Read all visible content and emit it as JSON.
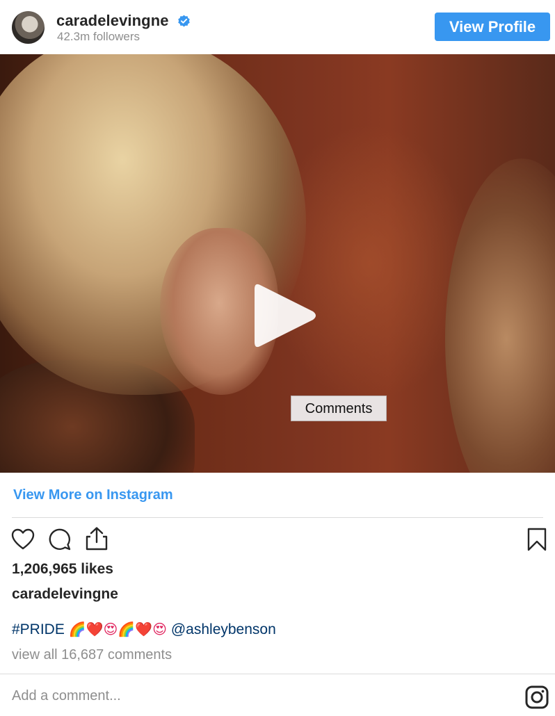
{
  "header": {
    "username": "caradelevingne",
    "followers": "42.3m followers",
    "view_profile_label": "View Profile"
  },
  "media": {
    "tooltip": "Comments"
  },
  "post": {
    "view_more_label": "View More on Instagram",
    "likes": "1,206,965 likes",
    "caption_user": "caradelevingne",
    "caption_hashtag": "#PRIDE",
    "caption_emojis": "🌈❤️😍🌈❤️😍",
    "caption_mention": "@ashleybenson",
    "view_all_comments": "view all 16,687 comments",
    "add_comment_placeholder": "Add a comment..."
  },
  "icons": {
    "verified": "verified-badge-icon",
    "play": "play-icon",
    "like": "heart-icon",
    "comment": "comment-icon",
    "share": "share-icon",
    "save": "bookmark-icon",
    "instagram": "instagram-logo-icon"
  },
  "colors": {
    "accent": "#3897f0",
    "text": "#262626",
    "muted": "#8e8e8e",
    "link": "#003569"
  }
}
